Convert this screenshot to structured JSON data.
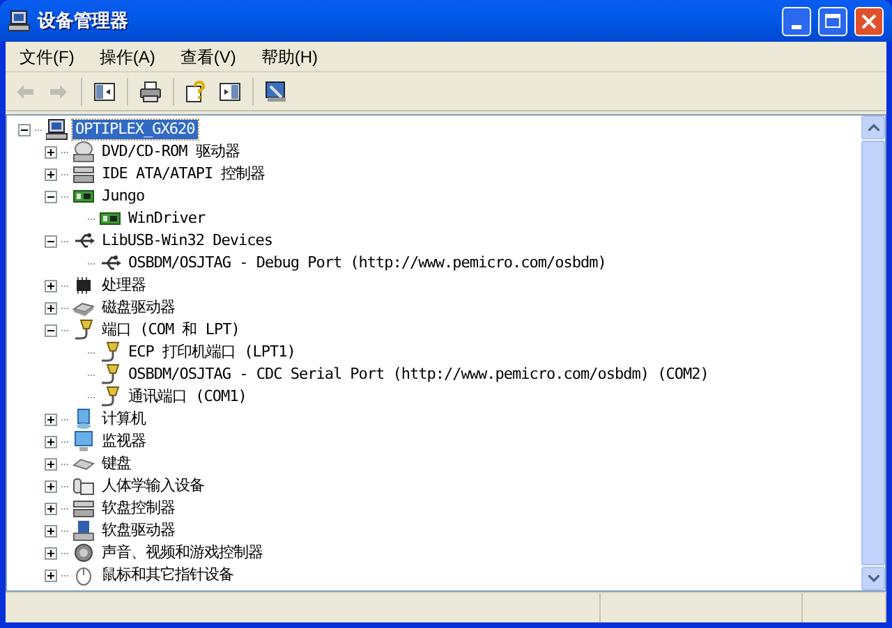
{
  "window": {
    "title": "设备管理器"
  },
  "menu": [
    {
      "label": "文件(F)"
    },
    {
      "label": "操作(A)"
    },
    {
      "label": "查看(V)"
    },
    {
      "label": "帮助(H)"
    }
  ],
  "toolbar": [
    {
      "kind": "back",
      "disabled": true
    },
    {
      "kind": "forward",
      "disabled": true
    },
    {
      "kind": "sep"
    },
    {
      "kind": "tree",
      "disabled": false
    },
    {
      "kind": "sep"
    },
    {
      "kind": "print",
      "disabled": false
    },
    {
      "kind": "sep"
    },
    {
      "kind": "help",
      "disabled": false
    },
    {
      "kind": "pane",
      "disabled": false
    },
    {
      "kind": "sep"
    },
    {
      "kind": "driver",
      "disabled": false
    }
  ],
  "tree": [
    {
      "label": "OPTIPLEX_GX620",
      "kind": "computer",
      "selected": true,
      "expanded": true,
      "children": [
        {
          "label": "DVD/CD-ROM 驱动器",
          "kind": "disc",
          "selected": false,
          "expanded": false
        },
        {
          "label": "IDE ATA/ATAPI 控制器",
          "kind": "controller",
          "selected": false,
          "expanded": false
        },
        {
          "label": "Jungo",
          "kind": "card",
          "selected": false,
          "expanded": true,
          "children": [
            {
              "label": "WinDriver",
              "kind": "card",
              "selected": false
            }
          ]
        },
        {
          "label": "LibUSB-Win32 Devices",
          "kind": "usb",
          "selected": false,
          "expanded": true,
          "children": [
            {
              "label": "OSBDM/OSJTAG - Debug Port (http://www.pemicro.com/osbdm)",
              "kind": "usb",
              "selected": false
            }
          ]
        },
        {
          "label": "处理器",
          "kind": "chip",
          "selected": false,
          "expanded": false
        },
        {
          "label": "磁盘驱动器",
          "kind": "disk",
          "selected": false,
          "expanded": false
        },
        {
          "label": "端口 (COM 和 LPT)",
          "kind": "port",
          "selected": false,
          "expanded": true,
          "children": [
            {
              "label": "ECP 打印机端口 (LPT1)",
              "kind": "port",
              "selected": false
            },
            {
              "label": "OSBDM/OSJTAG - CDC Serial Port (http://www.pemicro.com/osbdm) (COM2)",
              "kind": "port",
              "selected": false
            },
            {
              "label": "通讯端口 (COM1)",
              "kind": "port",
              "selected": false
            }
          ]
        },
        {
          "label": "计算机",
          "kind": "pc",
          "selected": false,
          "expanded": false
        },
        {
          "label": "监视器",
          "kind": "monitor",
          "selected": false,
          "expanded": false
        },
        {
          "label": "键盘",
          "kind": "keyboard",
          "selected": false,
          "expanded": false
        },
        {
          "label": "人体学输入设备",
          "kind": "hid",
          "selected": false,
          "expanded": false
        },
        {
          "label": "软盘控制器",
          "kind": "controller",
          "selected": false,
          "expanded": false
        },
        {
          "label": "软盘驱动器",
          "kind": "floppy",
          "selected": false,
          "expanded": false
        },
        {
          "label": "声音、视频和游戏控制器",
          "kind": "sound",
          "selected": false,
          "expanded": false
        },
        {
          "label": "鼠标和其它指针设备",
          "kind": "mouse",
          "selected": false,
          "expanded": false
        }
      ]
    }
  ]
}
